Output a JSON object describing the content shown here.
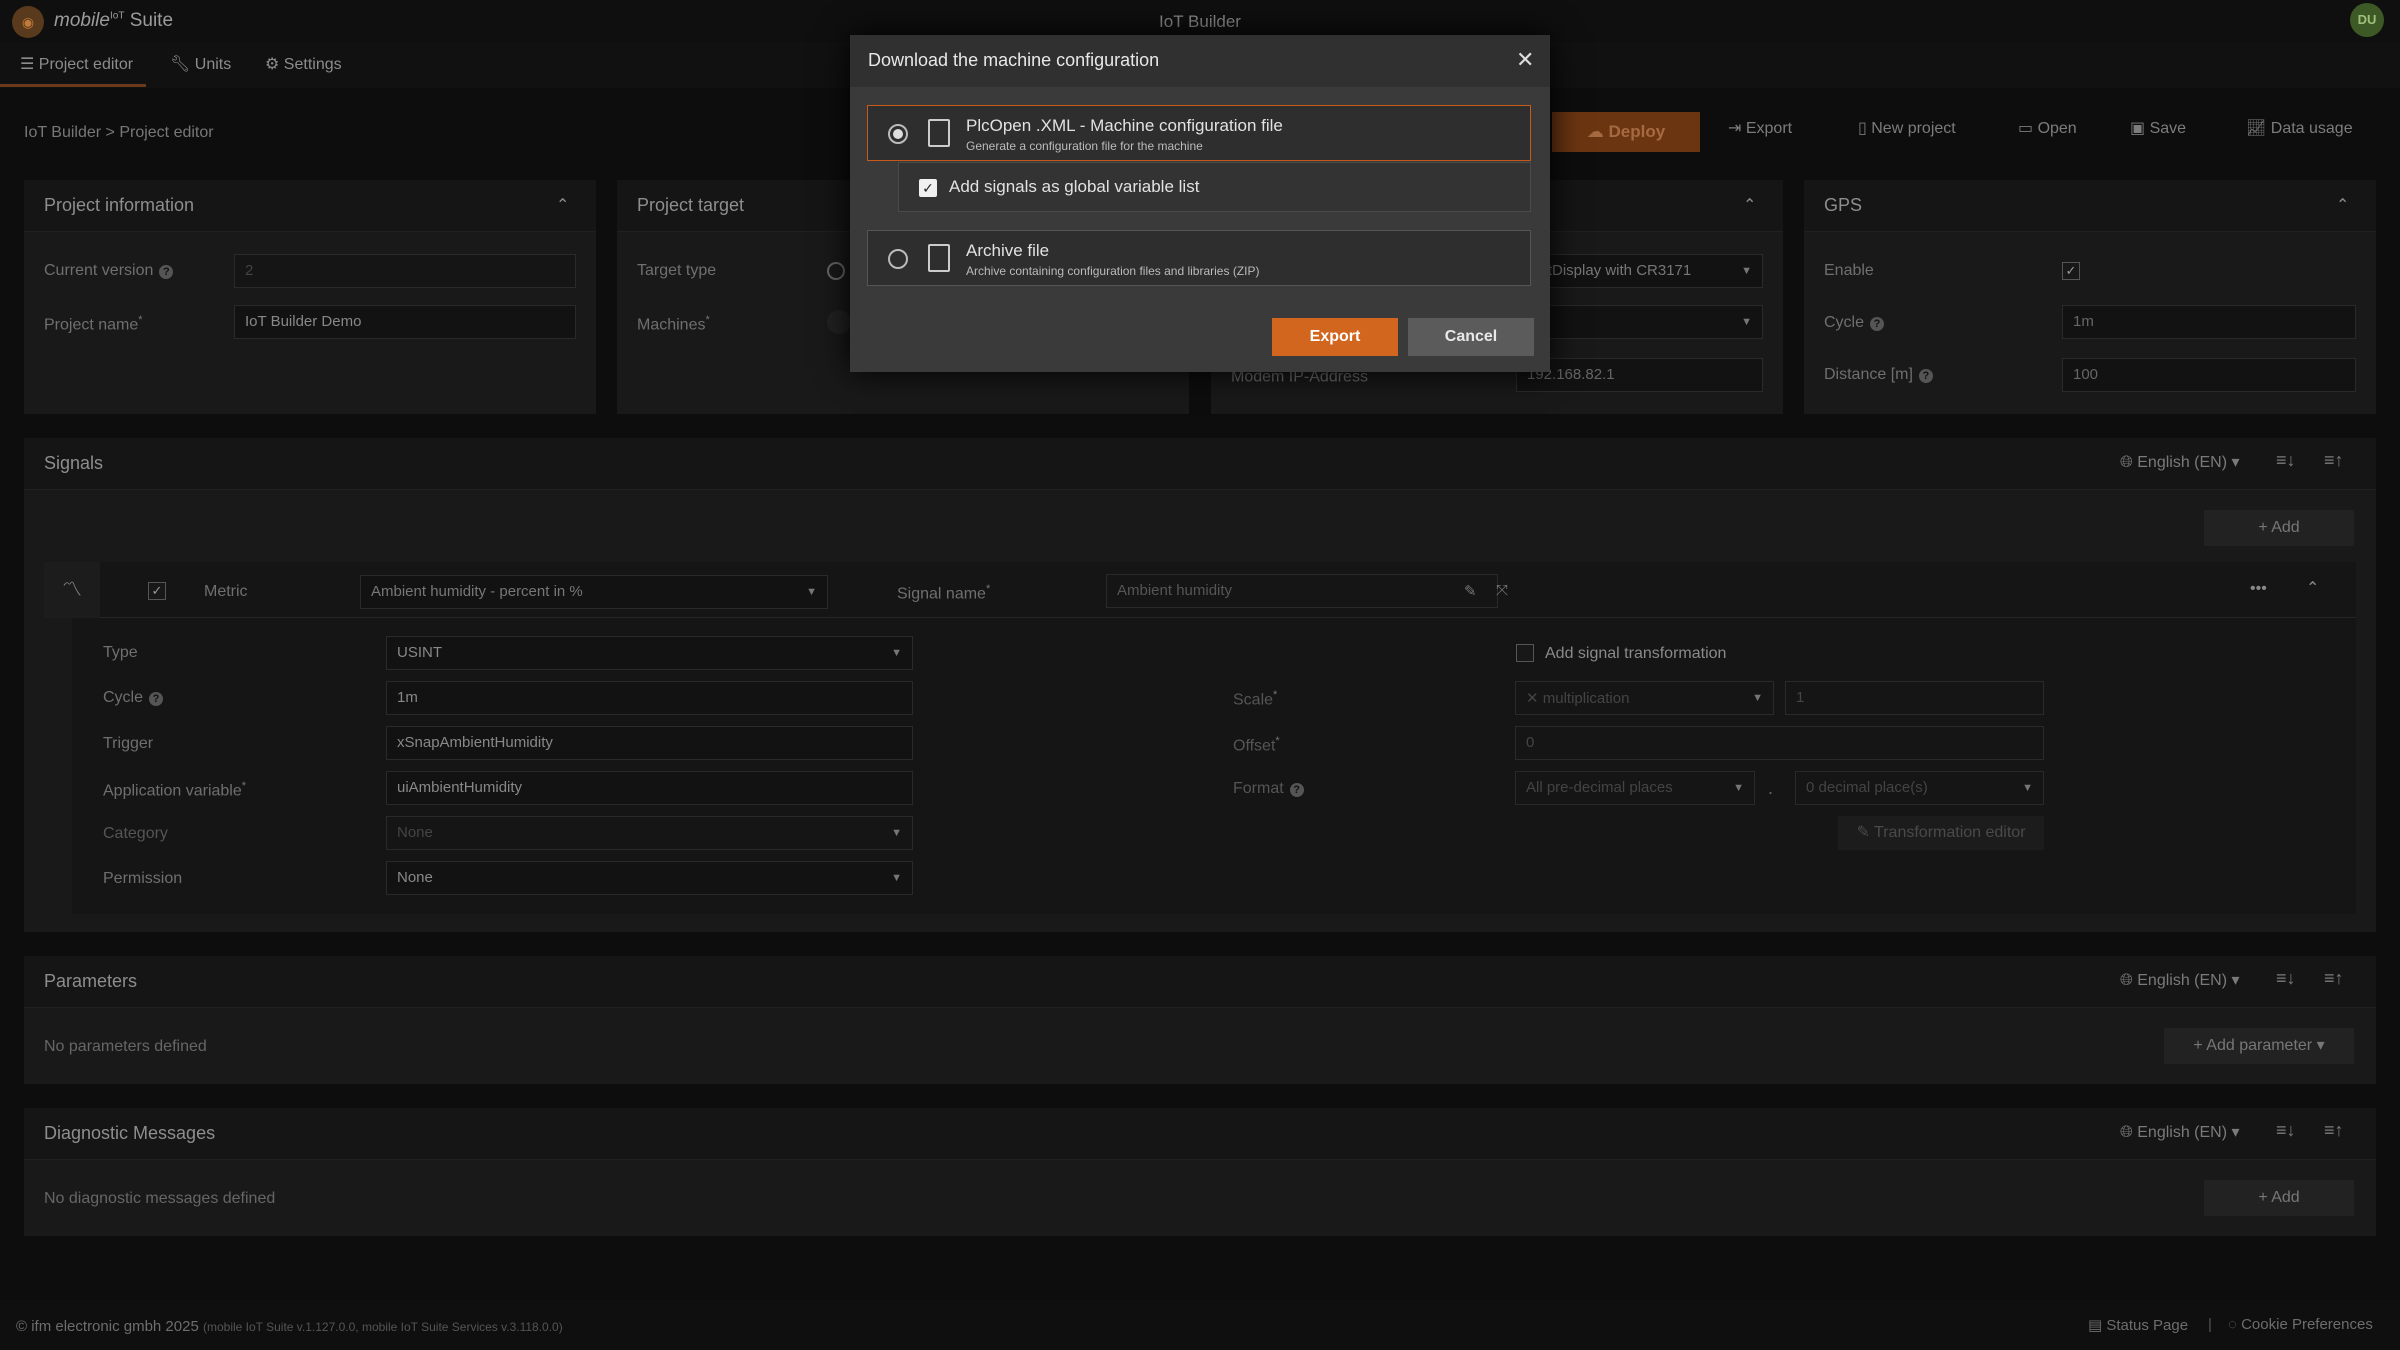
{
  "app": {
    "brand_prefix": "mobile",
    "brand_sup": "IoT",
    "brand_suffix": "Suite",
    "title": "IoT Builder",
    "avatar": "DU"
  },
  "nav": {
    "tabs": [
      "Project editor",
      "Units",
      "Settings"
    ]
  },
  "breadcrumb": {
    "root": "IoT Builder",
    "sep": ">",
    "current": "Project editor"
  },
  "toolbar": {
    "deploy": "Deploy",
    "export": "Export",
    "new_project": "New project",
    "open": "Open",
    "save": "Save",
    "data_usage": "Data usage"
  },
  "project_info": {
    "title": "Project information",
    "current_version_label": "Current version",
    "current_version": "2",
    "project_name_label": "Project name",
    "project_name": "IoT Builder Demo"
  },
  "project_target": {
    "title": "Project target",
    "target_type_label": "Target type",
    "machines_label": "Machines"
  },
  "device_panel": {
    "device_value": "matDisplay with CR3171",
    "modem_ip_label": "Modem IP-Address",
    "modem_ip": "192.168.82.1"
  },
  "gps": {
    "title": "GPS",
    "enable_label": "Enable",
    "cycle_label": "Cycle",
    "cycle": "1m",
    "distance_label": "Distance [m]",
    "distance": "100"
  },
  "signals": {
    "title": "Signals",
    "language": "English (EN)",
    "add": "Add",
    "metric_label": "Metric",
    "metric_value": "Ambient humidity - percent in %",
    "signal_name_label": "Signal name",
    "signal_name": "Ambient humidity",
    "type_label": "Type",
    "type": "USINT",
    "cycle_label": "Cycle",
    "cycle": "1m",
    "trigger_label": "Trigger",
    "trigger": "xSnapAmbientHumidity",
    "app_var_label": "Application variable",
    "app_var": "uiAmbientHumidity",
    "category_label": "Category",
    "category": "None",
    "permission_label": "Permission",
    "permission": "None",
    "add_transformation": "Add signal transformation",
    "scale_label": "Scale",
    "scale_op": "multiplication",
    "scale_value": "1",
    "offset_label": "Offset",
    "offset_value": "0",
    "format_label": "Format",
    "format_pre": "All pre-decimal places",
    "format_sep": ".",
    "format_dec": "0 decimal place(s)",
    "transformation_editor": "Transformation editor"
  },
  "parameters": {
    "title": "Parameters",
    "language": "English (EN)",
    "empty": "No parameters defined",
    "add": "Add parameter"
  },
  "diagnostics": {
    "title": "Diagnostic Messages",
    "language": "English (EN)",
    "empty": "No diagnostic messages defined",
    "add": "Add"
  },
  "footer": {
    "copyright": "© ifm electronic gmbh 2025",
    "version": "(mobile IoT Suite v.1.127.0.0, mobile IoT Suite Services v.3.118.0.0)",
    "status_page": "Status Page",
    "sep": "|",
    "cookies": "Cookie Preferences"
  },
  "modal": {
    "title": "Download the machine configuration",
    "option1_title": "PlcOpen .XML - Machine configuration file",
    "option1_sub": "Generate a configuration file for the machine",
    "suboption": "Add signals as global variable list",
    "option2_title": "Archive file",
    "option2_sub": "Archive containing configuration files and libraries (ZIP)",
    "export": "Export",
    "cancel": "Cancel"
  },
  "colors": {
    "accent": "#d2661e",
    "modal_bg": "#3a3a3a",
    "page_bg": "#0d0d0d"
  }
}
